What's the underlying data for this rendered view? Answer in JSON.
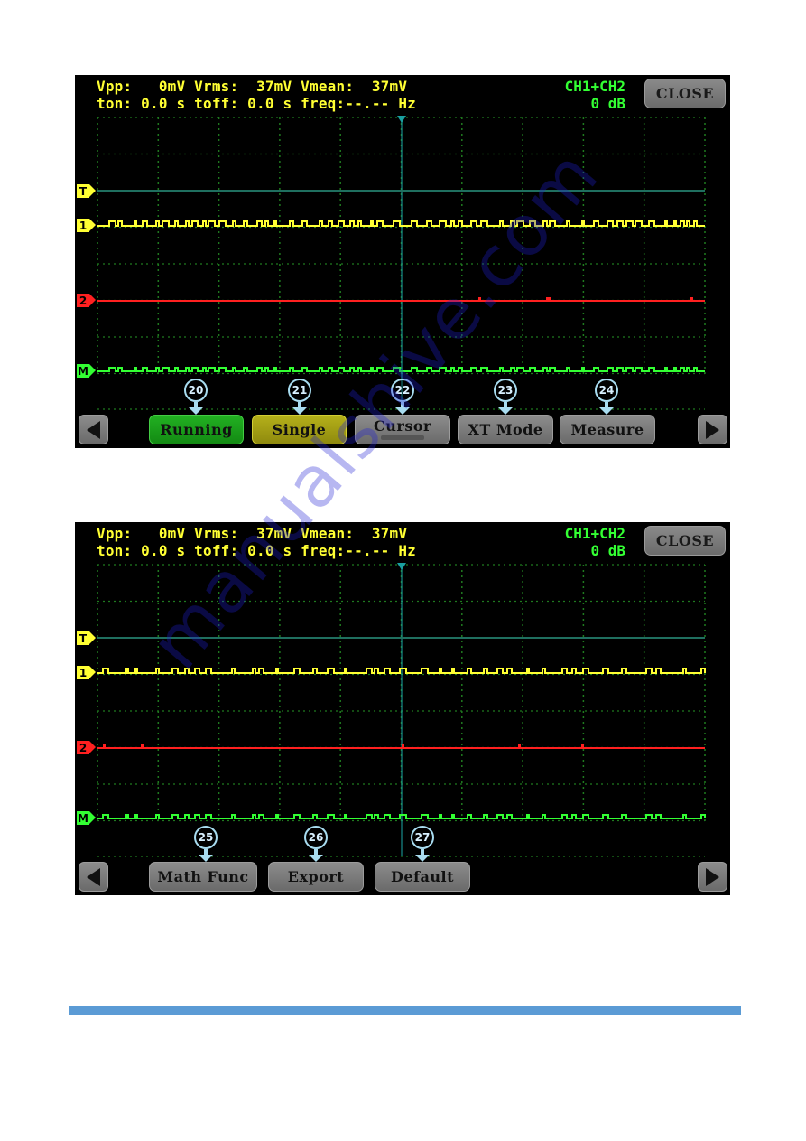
{
  "colors": {
    "ch1": "#ffff33",
    "ch2": "#ff2020",
    "math": "#33ff33",
    "trigger_line": "#1f6f5f",
    "grid": "#1f7a1f",
    "cursor_line": "#1aa0a0",
    "divider_bar": "#5b9bd5"
  },
  "screens": [
    {
      "measurements": {
        "vpp_label": "Vpp:",
        "vpp_value": "0mV",
        "vrms_label": "Vrms:",
        "vrms_value": "37mV",
        "vmean_label": "Vmean:",
        "vmean_value": "37mV",
        "ton_label": "ton:",
        "ton_value": "0.0 s",
        "toff_label": "toff:",
        "toff_value": "0.0 s",
        "freq_label": "freq:",
        "freq_value": "--.-- Hz",
        "row1": "Vpp:   0mV Vrms:  37mV Vmean:  37mV",
        "row2": "ton: 0.0 s toff: 0.0 s freq:--.-- Hz"
      },
      "channel_info": {
        "source": "CH1+CH2",
        "gain": "0 dB"
      },
      "close_label": "CLOSE",
      "markers": {
        "trigger": "T",
        "ch1": "1",
        "ch2": "2",
        "math": "M"
      },
      "buttons": [
        {
          "label": "Running",
          "callout": "20",
          "style": "running"
        },
        {
          "label": "Single",
          "callout": "21",
          "style": "single"
        },
        {
          "label": "Cursor",
          "callout": "22",
          "style": "cursor"
        },
        {
          "label": "XT Mode",
          "callout": "23",
          "style": "gray"
        },
        {
          "label": "Measure",
          "callout": "24",
          "style": "gray"
        }
      ],
      "nav": {
        "prev": "left-arrow",
        "next": "right-arrow"
      }
    },
    {
      "measurements": {
        "row1": "Vpp:   0mV Vrms:  37mV Vmean:  37mV",
        "row2": "ton: 0.0 s toff: 0.0 s freq:--.-- Hz"
      },
      "channel_info": {
        "source": "CH1+CH2",
        "gain": "0 dB"
      },
      "close_label": "CLOSE",
      "markers": {
        "trigger": "T",
        "ch1": "1",
        "ch2": "2",
        "math": "M"
      },
      "buttons": [
        {
          "label": "Math Func",
          "callout": "25",
          "style": "gray"
        },
        {
          "label": "Export",
          "callout": "26",
          "style": "gray"
        },
        {
          "label": "Default",
          "callout": "27",
          "style": "gray"
        }
      ],
      "nav": {
        "prev": "left-arrow",
        "next": "right-arrow"
      }
    }
  ],
  "watermark": "manualshive.com"
}
